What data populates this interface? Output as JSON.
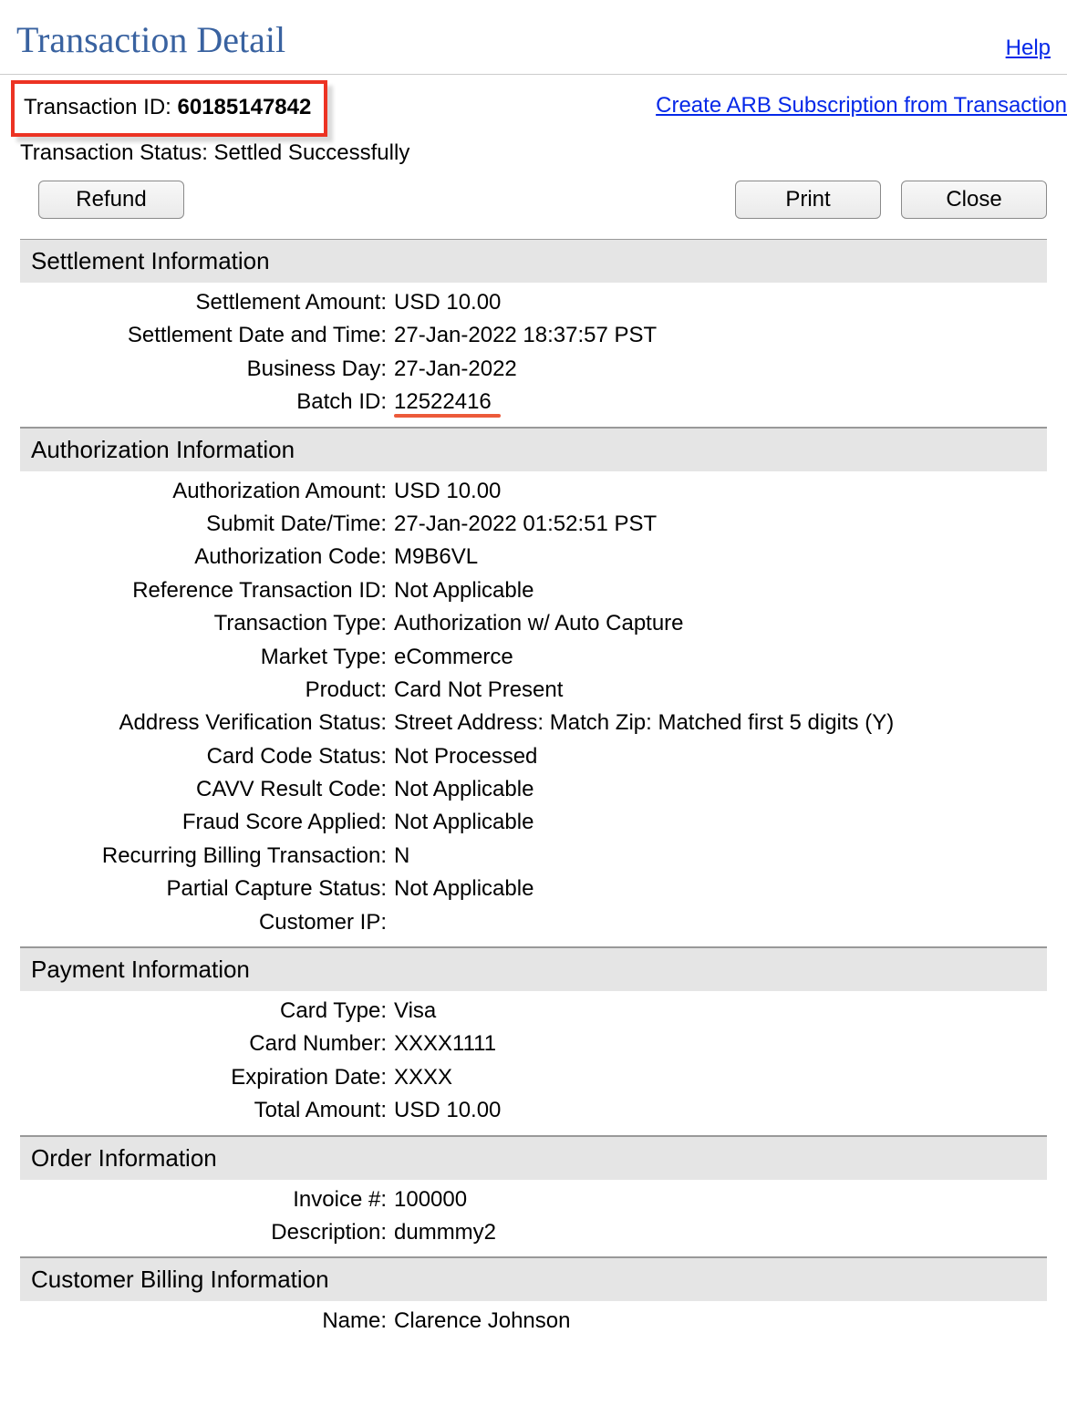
{
  "header": {
    "title": "Transaction Detail",
    "help": "Help"
  },
  "txn": {
    "id_label": "Transaction ID: ",
    "id_value": "60185147842",
    "arb_link": "Create ARB Subscription from Transaction",
    "status_label": "Transaction Status: ",
    "status_value": "Settled Successfully"
  },
  "buttons": {
    "refund": "Refund",
    "print": "Print",
    "close": "Close"
  },
  "sections": {
    "settlement": {
      "title": "Settlement Information",
      "rows": [
        {
          "label": "Settlement Amount:",
          "value": "USD 10.00"
        },
        {
          "label": "Settlement Date and Time:",
          "value": "27-Jan-2022 18:37:57 PST"
        },
        {
          "label": "Business Day:",
          "value": "27-Jan-2022"
        },
        {
          "label": "Batch ID:",
          "value": "12522416"
        }
      ]
    },
    "authorization": {
      "title": "Authorization Information",
      "rows": [
        {
          "label": "Authorization Amount:",
          "value": "USD 10.00"
        },
        {
          "label": "Submit Date/Time:",
          "value": "27-Jan-2022 01:52:51 PST"
        },
        {
          "label": "Authorization Code:",
          "value": "M9B6VL"
        },
        {
          "label": "Reference Transaction ID:",
          "value": "Not Applicable"
        },
        {
          "label": "Transaction Type:",
          "value": "Authorization w/ Auto Capture"
        },
        {
          "label": "Market Type:",
          "value": "eCommerce"
        },
        {
          "label": "Product:",
          "value": "Card Not Present"
        },
        {
          "label": "Address Verification Status:",
          "value": "Street Address: Match Zip: Matched first 5 digits (Y)"
        },
        {
          "label": "Card Code Status:",
          "value": "Not Processed"
        },
        {
          "label": "CAVV Result Code:",
          "value": "Not Applicable"
        },
        {
          "label": "Fraud Score Applied:",
          "value": "Not Applicable"
        },
        {
          "label": "Recurring Billing Transaction:",
          "value": "N"
        },
        {
          "label": "Partial Capture Status:",
          "value": "Not Applicable"
        },
        {
          "label": "Customer IP:",
          "value": ""
        }
      ]
    },
    "payment": {
      "title": "Payment Information",
      "rows": [
        {
          "label": "Card Type:",
          "value": "Visa"
        },
        {
          "label": "Card Number:",
          "value": "XXXX1111"
        },
        {
          "label": "Expiration Date:",
          "value": "XXXX"
        },
        {
          "label": "Total Amount:",
          "value": "USD 10.00"
        }
      ]
    },
    "order": {
      "title": "Order Information",
      "rows": [
        {
          "label": "Invoice #:",
          "value": "100000"
        },
        {
          "label": "Description:",
          "value": "dummmy2"
        }
      ]
    },
    "billing": {
      "title": "Customer Billing Information",
      "rows": [
        {
          "label": "Name:",
          "value": "Clarence Johnson"
        }
      ]
    }
  }
}
